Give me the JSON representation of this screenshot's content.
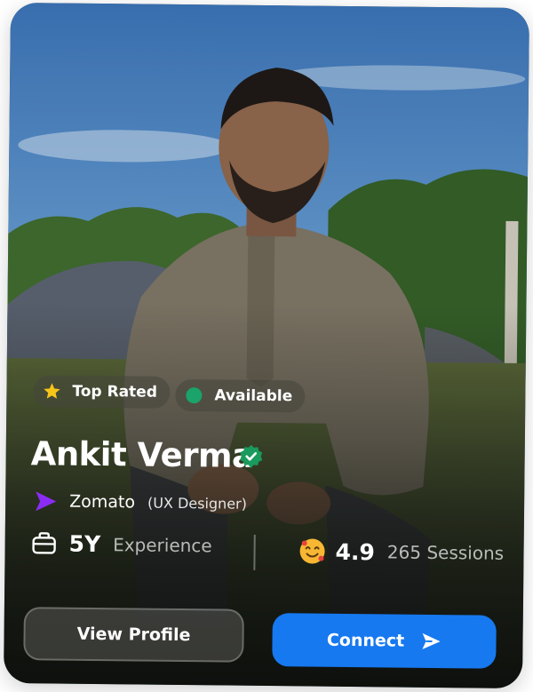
{
  "badges": {
    "top_rated": "Top Rated",
    "available": "Available"
  },
  "profile": {
    "name": "Ankit Verma",
    "company": "Zomato",
    "role": "(UX Designer)"
  },
  "stats": {
    "experience_value": "5Y",
    "experience_label": "Experience",
    "rating_value": "4.9",
    "sessions_label": "265 Sessions"
  },
  "actions": {
    "view_profile": "View Profile",
    "connect": "Connect"
  },
  "colors": {
    "accent": "#1679f0",
    "verified": "#1a9a5c",
    "available_dot": "#1aa36a",
    "company_logo": "#8b2cf5"
  },
  "icons": {
    "star": "star-icon",
    "status": "available-dot-icon",
    "verified": "verified-badge-icon",
    "logo": "company-logo-icon",
    "briefcase": "briefcase-icon",
    "emoji": "smiling-face-icon",
    "send": "send-icon"
  }
}
